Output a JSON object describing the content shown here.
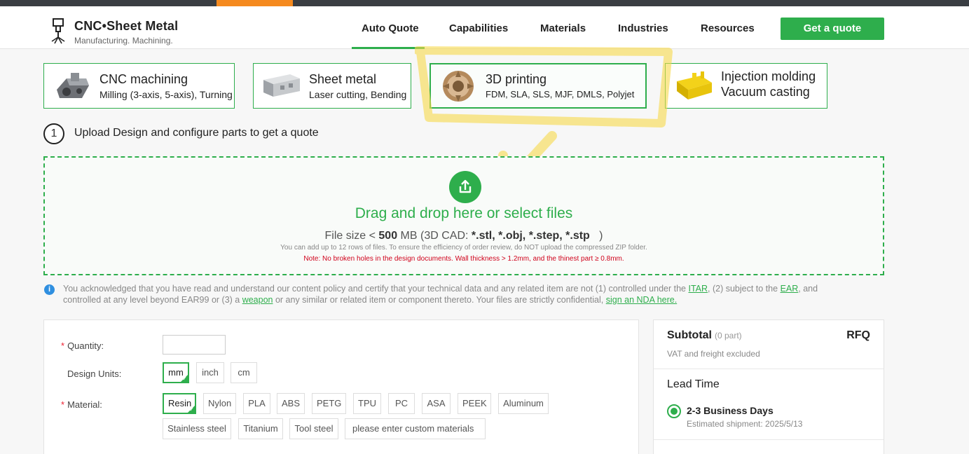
{
  "brand": {
    "name": "CNC•Sheet Metal",
    "tagline": "Manufacturing. Machining."
  },
  "nav": {
    "items": [
      "Auto Quote",
      "Capabilities",
      "Materials",
      "Industries",
      "Resources"
    ],
    "active": "Auto Quote",
    "cta": "Get a quote"
  },
  "categories": [
    {
      "title": "CNC machining",
      "subtitle": "Milling (3-axis, 5-axis), Turning",
      "icon": "cnc-part-image"
    },
    {
      "title": "Sheet metal",
      "subtitle": "Laser cutting, Bending",
      "icon": "sheet-metal-part-image"
    },
    {
      "title": "3D printing",
      "subtitle": "FDM, SLA, SLS, MJF, DMLS, Polyjet",
      "icon": "3d-print-part-image",
      "selected": true
    },
    {
      "title": "Injection molding",
      "subtitle": "Vacuum casting",
      "icon": "molded-part-image"
    }
  ],
  "step": {
    "number": "1",
    "text": "Upload Design and configure parts to get a quote"
  },
  "upload": {
    "icon": "upload-icon",
    "title": "Drag and drop here or select files",
    "size_prefix": "File size < ",
    "size_value": "500",
    "size_mid": " MB (3D CAD: ",
    "formats": "*.stl, *.obj, *.step, *.stp",
    "size_suffix": "   )",
    "add_info": "You can add up to 12 rows of files. To ensure the efficiency of order review, do NOT upload the compressed ZIP folder.",
    "note": "Note: No broken holes in the design documents. Wall thickness > 1.2mm, and the thinest part ≥ 0.8mm."
  },
  "ack": {
    "t1": "You acknowledged that you have read and understand our content policy and certify that your technical data and any related item are not (1) controlled under the ",
    "l1": "ITAR",
    "t2": ", (2) subject to the ",
    "l2": "EAR",
    "t3": ", and controlled at any level beyond EAR99 or (3) a ",
    "l3": "weapon",
    "t4": " or any similar or related item or component thereto. Your files are strictly confidential, ",
    "l4": "sign an NDA here."
  },
  "config": {
    "quantity_label": "Quantity:",
    "quantity_value": "",
    "units_label": "Design Units:",
    "units": [
      "mm",
      "inch",
      "cm"
    ],
    "units_selected": "mm",
    "material_label": "Material:",
    "materials": [
      "Resin",
      "Nylon",
      "PLA",
      "ABS",
      "PETG",
      "TPU",
      "PC",
      "ASA",
      "PEEK",
      "Aluminum",
      "Stainless steel",
      "Titanium",
      "Tool steel"
    ],
    "material_selected": "Resin",
    "custom_placeholder": "please enter custom materials",
    "required_mark": "*"
  },
  "summary": {
    "title": "Subtotal",
    "parts": "(0 part)",
    "price": "RFQ",
    "vat": "VAT and freight excluded",
    "lead_title": "Lead Time",
    "lead_option": "2-3 Business Days",
    "shipment": "Estimated shipment: 2025/5/13"
  },
  "colors": {
    "accent": "#2eae4c",
    "topbar": "#3a3e43",
    "topbar_accent": "#f58a1f",
    "highlight": "#f7d84a",
    "note": "#d0021b",
    "link": "#2eae4c"
  }
}
